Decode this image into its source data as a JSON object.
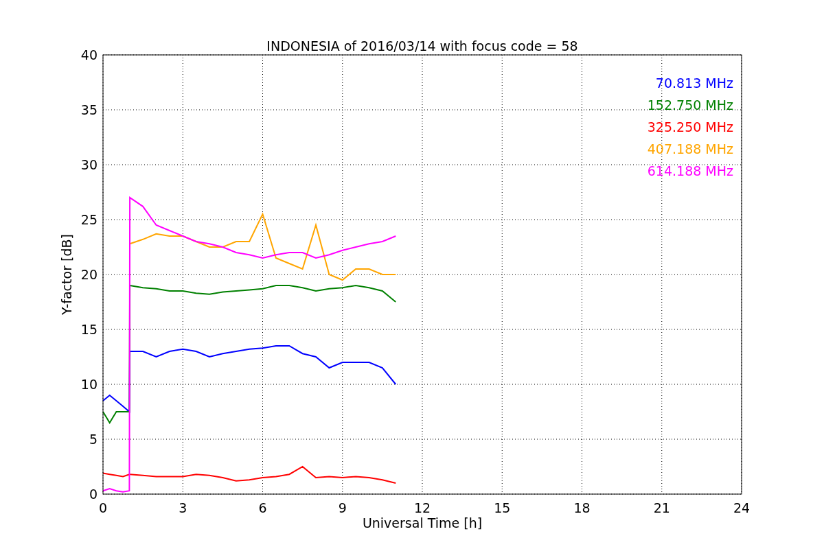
{
  "chart_data": {
    "type": "line",
    "title": "INDONESIA of 2016/03/14 with focus code = 58",
    "xlabel": "Universal Time [h]",
    "ylabel": "Y-factor [dB]",
    "x": [
      0,
      0.25,
      0.5,
      0.75,
      0.99,
      1.01,
      1.5,
      2,
      2.5,
      3,
      3.5,
      4,
      4.5,
      5,
      5.5,
      6,
      6.5,
      7,
      7.5,
      8,
      8.5,
      9,
      9.5,
      10,
      10.5,
      11
    ],
    "series": [
      {
        "name": "70.813 MHz",
        "color": "#0000ff",
        "values": [
          8.5,
          9,
          8.5,
          8,
          7.5,
          13,
          13,
          12.5,
          13,
          13.2,
          13,
          12.5,
          12.8,
          13,
          13.2,
          13.3,
          13.5,
          13.5,
          12.8,
          12.5,
          11.5,
          12,
          12,
          12,
          11.5,
          10
        ]
      },
      {
        "name": "152.750 MHz",
        "color": "#008000",
        "values": [
          7.5,
          6.5,
          7.5,
          7.5,
          7.5,
          19,
          18.8,
          18.7,
          18.5,
          18.5,
          18.3,
          18.2,
          18.4,
          18.5,
          18.6,
          18.7,
          19,
          19,
          18.8,
          18.5,
          18.7,
          18.8,
          19,
          18.8,
          18.5,
          17.5
        ]
      },
      {
        "name": "325.250 MHz",
        "color": "#ff0000",
        "values": [
          1.9,
          1.8,
          1.7,
          1.6,
          1.8,
          1.8,
          1.7,
          1.6,
          1.6,
          1.6,
          1.8,
          1.7,
          1.5,
          1.2,
          1.3,
          1.5,
          1.6,
          1.8,
          2.5,
          1.5,
          1.6,
          1.5,
          1.6,
          1.5,
          1.3,
          1
        ]
      },
      {
        "name": "407.188 MHz",
        "color": "#ffa500",
        "values": [
          null,
          null,
          null,
          null,
          null,
          22.8,
          23.2,
          23.7,
          23.5,
          23.5,
          23,
          22.5,
          22.5,
          23,
          23,
          25.5,
          21.5,
          21,
          20.5,
          24.5,
          20,
          19.5,
          20.5,
          20.5,
          20,
          20
        ]
      },
      {
        "name": "614.188 MHz",
        "color": "#ff00ff",
        "values": [
          0.3,
          0.5,
          0.3,
          0.2,
          0.3,
          27,
          26.2,
          24.5,
          24,
          23.5,
          23,
          22.8,
          22.5,
          22,
          21.8,
          21.5,
          21.8,
          22,
          22,
          21.5,
          21.8,
          22.2,
          22.5,
          22.8,
          23,
          23.5
        ]
      }
    ],
    "xlim": [
      0,
      24
    ],
    "ylim": [
      0,
      40
    ],
    "xticks": [
      0,
      3,
      6,
      9,
      12,
      15,
      18,
      21,
      24
    ],
    "yticks": [
      0,
      5,
      10,
      15,
      20,
      25,
      30,
      35,
      40
    ],
    "grid": true
  }
}
